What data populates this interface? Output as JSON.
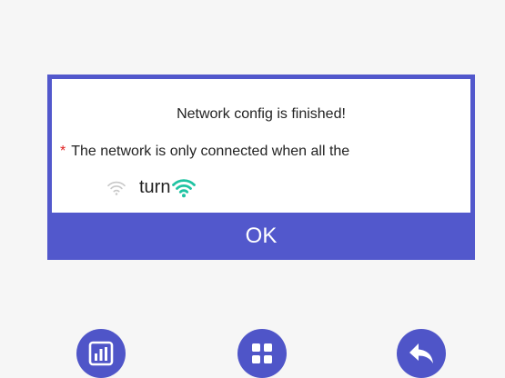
{
  "dialog": {
    "title": "Network config is finished!",
    "warning_marker": "*",
    "warning_text": "The network is only connected when all the",
    "icon_row_text": "turn",
    "ok_label": "OK",
    "colors": {
      "frame": "#5258cc",
      "warning_star": "#e02020",
      "wifi_gray": "#c8c8c8",
      "wifi_green": "#1fc3a2"
    }
  },
  "bottom_bar": {
    "buttons": [
      {
        "icon": "bar-chart-icon"
      },
      {
        "icon": "grid-menu-icon"
      },
      {
        "icon": "back-arrow-icon"
      }
    ],
    "color": "#4f55c8"
  }
}
